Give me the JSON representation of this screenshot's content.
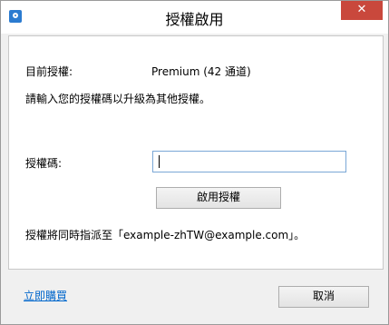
{
  "window": {
    "title": "授權啟用",
    "close_glyph": "✕",
    "icon": "app-icon"
  },
  "license": {
    "label": "目前授權:",
    "value": "Premium (42 通道)"
  },
  "prompt": "請輸入您的授權碼以升級為其他授權。",
  "key": {
    "label": "授權碼:",
    "value": ""
  },
  "activate_button": "啟用授權",
  "assign_note": "授權將同時指派至「example-zhTW@example.com」。",
  "buy_link": "立即購買",
  "cancel_button": "取消",
  "colors": {
    "accent": "#2b7bd0",
    "close": "#c9483c",
    "link": "#0066cc"
  }
}
